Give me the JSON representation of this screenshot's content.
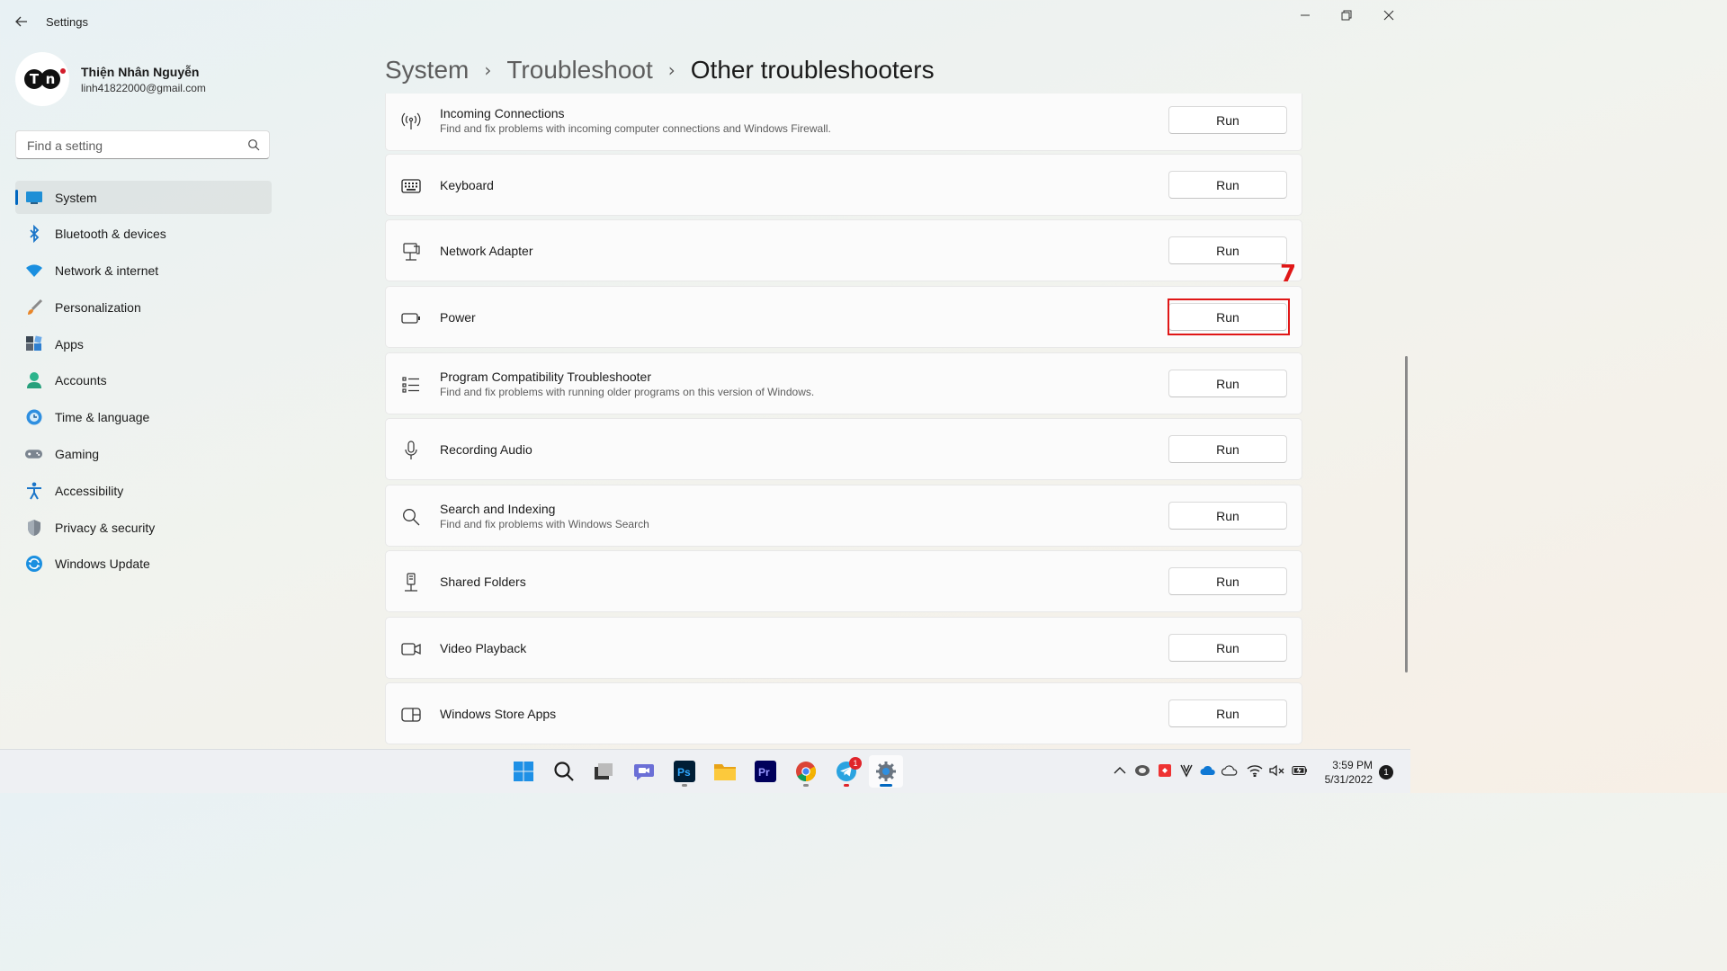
{
  "window": {
    "title": "Settings",
    "back_icon": "back-arrow-icon",
    "controls": [
      "minimize-icon",
      "restore-icon",
      "close-icon"
    ]
  },
  "profile": {
    "avatar_text": "TN",
    "name": "Thiện Nhân Nguyễn",
    "email": "linh41822000@gmail.com"
  },
  "search": {
    "placeholder": "Find a setting",
    "value": "",
    "icon": "search-icon"
  },
  "sidebar": {
    "items": [
      {
        "label": "System",
        "icon": "system-monitor-icon",
        "active": true
      },
      {
        "label": "Bluetooth & devices",
        "icon": "bluetooth-icon"
      },
      {
        "label": "Network & internet",
        "icon": "wifi-icon"
      },
      {
        "label": "Personalization",
        "icon": "paintbrush-icon"
      },
      {
        "label": "Apps",
        "icon": "apps-icon"
      },
      {
        "label": "Accounts",
        "icon": "accounts-icon"
      },
      {
        "label": "Time & language",
        "icon": "time-language-icon"
      },
      {
        "label": "Gaming",
        "icon": "gamepad-icon"
      },
      {
        "label": "Accessibility",
        "icon": "accessibility-icon"
      },
      {
        "label": "Privacy & security",
        "icon": "shield-icon"
      },
      {
        "label": "Windows Update",
        "icon": "windows-update-icon"
      }
    ]
  },
  "breadcrumb": {
    "items": [
      "System",
      "Troubleshoot"
    ],
    "current": "Other troubleshooters",
    "separator": "›"
  },
  "troubleshooters": [
    {
      "title": "Incoming Connections",
      "desc": "Find and fix problems with incoming computer connections and Windows Firewall.",
      "icon": "antenna-icon",
      "button": "Run"
    },
    {
      "title": "Keyboard",
      "desc": "",
      "icon": "keyboard-icon",
      "button": "Run"
    },
    {
      "title": "Network Adapter",
      "desc": "",
      "icon": "network-adapter-icon",
      "button": "Run"
    },
    {
      "title": "Power",
      "desc": "",
      "icon": "battery-icon",
      "button": "Run",
      "highlighted": true
    },
    {
      "title": "Program Compatibility Troubleshooter",
      "desc": "Find and fix problems with running older programs on this version of Windows.",
      "icon": "list-icon",
      "button": "Run"
    },
    {
      "title": "Recording Audio",
      "desc": "",
      "icon": "microphone-icon",
      "button": "Run"
    },
    {
      "title": "Search and Indexing",
      "desc": "Find and fix problems with Windows Search",
      "icon": "search-icon",
      "button": "Run"
    },
    {
      "title": "Shared Folders",
      "desc": "",
      "icon": "shared-folders-icon",
      "button": "Run"
    },
    {
      "title": "Video Playback",
      "desc": "",
      "icon": "video-camera-icon",
      "button": "Run"
    },
    {
      "title": "Windows Store Apps",
      "desc": "",
      "icon": "store-apps-icon",
      "button": "Run"
    }
  ],
  "annotation": {
    "step_number": "7",
    "color": "#e01717"
  },
  "taskbar": {
    "apps": [
      "windows-start-icon",
      "search-icon",
      "task-view-icon",
      "teams-chat-icon",
      "photoshop-icon",
      "file-explorer-icon",
      "premiere-pro-icon",
      "chrome-icon",
      "telegram-icon",
      "settings-gear-icon"
    ],
    "telegram_badge": "1",
    "tray_icons": [
      "chevron-up-icon",
      "tray-app-icon",
      "tray-red-app-icon",
      "vector-v-icon",
      "onedrive-icon",
      "cloud-icon",
      "wifi-icon",
      "volume-muted-icon",
      "battery-charging-icon"
    ],
    "time": "3:59 PM",
    "date": "5/31/2022",
    "notification_count": "1"
  },
  "colors": {
    "accent": "#0067c0",
    "highlight": "#e01717"
  }
}
